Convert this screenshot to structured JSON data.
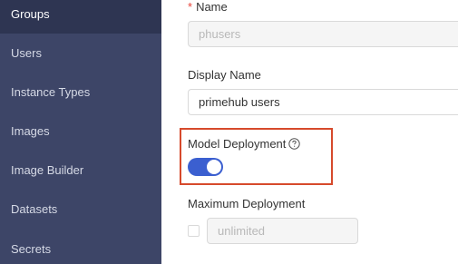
{
  "sidebar": {
    "items": [
      {
        "label": "Groups",
        "active": true
      },
      {
        "label": "Users"
      },
      {
        "label": "Instance Types"
      },
      {
        "label": "Images"
      },
      {
        "label": "Image Builder"
      },
      {
        "label": "Datasets"
      },
      {
        "label": "Secrets"
      }
    ]
  },
  "form": {
    "name": {
      "required_mark": "*",
      "label": "Name",
      "value": "phusers"
    },
    "display_name": {
      "label": "Display Name",
      "value": "primehub users"
    },
    "model_deployment": {
      "label": "Model Deployment",
      "help_icon": "question-circle-icon",
      "enabled": true
    },
    "maximum_deployment": {
      "label": "Maximum Deployment",
      "checked": false,
      "placeholder": "unlimited"
    }
  },
  "colors": {
    "sidebar_bg": "#3d4567",
    "sidebar_active_bg": "#2e3552",
    "toggle_on": "#3b5fd0",
    "highlight_border": "#d64a2c",
    "required": "#e8443a"
  }
}
